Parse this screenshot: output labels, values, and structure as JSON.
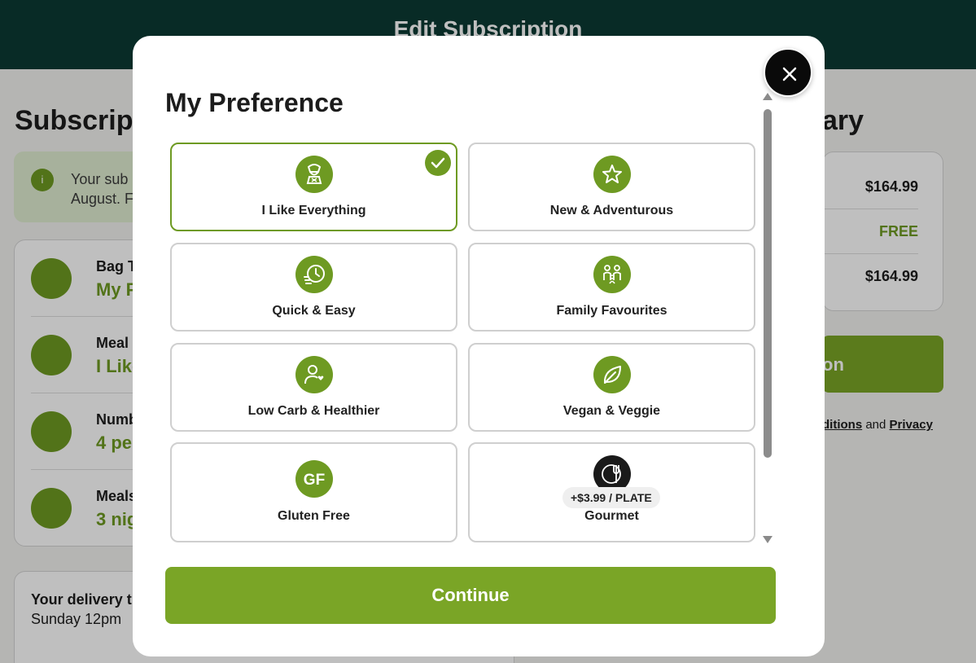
{
  "topbar": {
    "title": "Edit Subscription"
  },
  "background": {
    "heading_left": "Subscripti",
    "heading_right": "ary",
    "info_text_line1": "Your sub",
    "info_text_line2": "August. F",
    "rows": [
      {
        "label": "Bag T",
        "value": "My F"
      },
      {
        "label": "Meal",
        "value": "I Like"
      },
      {
        "label": "Numb",
        "value": "4 pe"
      },
      {
        "label": "Meals",
        "value": "3 nig"
      }
    ],
    "delivery_label": "Your delivery t",
    "delivery_value": "Sunday 12pm",
    "summary": {
      "line1": "$164.99",
      "line2": "FREE",
      "line3": "$164.99"
    },
    "button_label": "on",
    "terms_link1": "ditions",
    "terms_and": "and",
    "terms_link2": "Privacy"
  },
  "modal": {
    "title": "My Preference",
    "continue_label": "Continue",
    "options": [
      {
        "label": "I Like Everything",
        "icon": "chef-icon",
        "selected": true
      },
      {
        "label": "New & Adventurous",
        "icon": "star-icon",
        "selected": false
      },
      {
        "label": "Quick & Easy",
        "icon": "clock-icon",
        "selected": false
      },
      {
        "label": "Family Favourites",
        "icon": "family-icon",
        "selected": false
      },
      {
        "label": "Low Carb & Healthier",
        "icon": "person-heart-icon",
        "selected": false
      },
      {
        "label": "Vegan & Veggie",
        "icon": "leaf-icon",
        "selected": false
      },
      {
        "label": "Gluten Free",
        "icon": "gf-icon",
        "icon_text": "GF",
        "selected": false
      },
      {
        "label": "Gourmet",
        "icon": "cutlery-icon",
        "selected": false,
        "price_badge": "+$3.99 / PLATE"
      }
    ]
  },
  "colors": {
    "brand_green": "#7aa526",
    "dark_teal": "#0b3a33",
    "icon_green": "#6e9a22"
  }
}
